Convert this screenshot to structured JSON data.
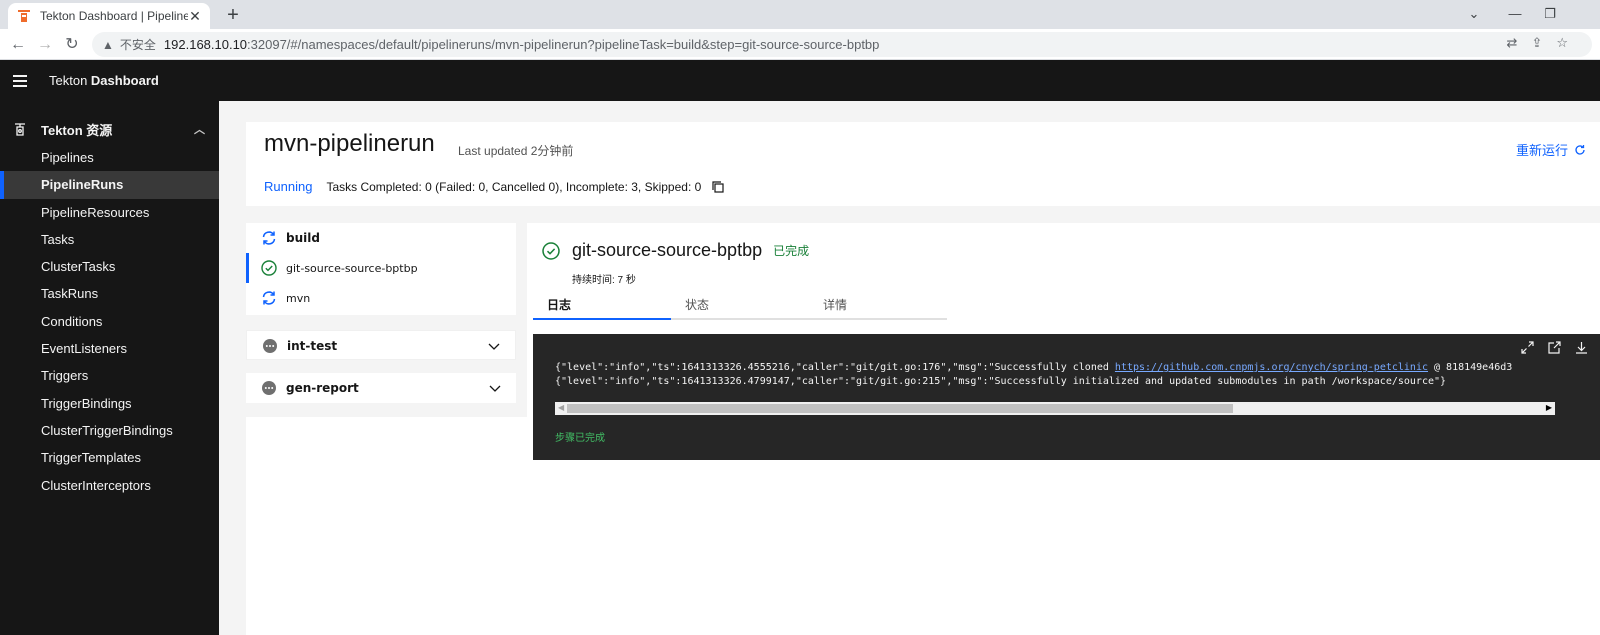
{
  "browser": {
    "tab_title": "Tekton Dashboard | PipelineRu",
    "new_tab_label": "+",
    "security_label": "不安全",
    "url_host": "192.168.10.10",
    "url_rest": ":32097/#/namespaces/default/pipelineruns/mvn-pipelinerun?pipelineTask=build&step=git-source-source-bptbp"
  },
  "app": {
    "brand_prefix": "Tekton ",
    "brand_bold": "Dashboard"
  },
  "sidebar": {
    "section_label": "Tekton 资源",
    "items": [
      {
        "label": "Pipelines"
      },
      {
        "label": "PipelineRuns"
      },
      {
        "label": "PipelineResources"
      },
      {
        "label": "Tasks"
      },
      {
        "label": "ClusterTasks"
      },
      {
        "label": "TaskRuns"
      },
      {
        "label": "Conditions"
      },
      {
        "label": "EventListeners"
      },
      {
        "label": "Triggers"
      },
      {
        "label": "TriggerBindings"
      },
      {
        "label": "ClusterTriggerBindings"
      },
      {
        "label": "TriggerTemplates"
      },
      {
        "label": "ClusterInterceptors"
      }
    ],
    "active_item": "PipelineRuns"
  },
  "pipelinerun": {
    "name": "mvn-pipelinerun",
    "last_updated": "Last updated 2分钟前",
    "rerun_label": "重新运行",
    "status": "Running",
    "tasks_summary": "Tasks Completed: 0 (Failed: 0, Cancelled 0), Incomplete: 3, Skipped: 0"
  },
  "tasks": {
    "build": {
      "label": "build",
      "steps": [
        {
          "label": "git-source-source-bptbp",
          "state": "success"
        },
        {
          "label": "mvn",
          "state": "running"
        }
      ]
    },
    "int_test": {
      "label": "int-test",
      "state": "pending"
    },
    "gen_report": {
      "label": "gen-report",
      "state": "pending"
    }
  },
  "step": {
    "name": "git-source-source-bptbp",
    "status": "已完成",
    "duration": "持续时间: 7 秒",
    "tabs": [
      {
        "label": "日志"
      },
      {
        "label": "状态"
      },
      {
        "label": "详情"
      }
    ],
    "active_tab": "日志"
  },
  "log": {
    "line1_prefix": "{\"level\":\"info\",\"ts\":1641313326.4555216,\"caller\":\"git/git.go:176\",\"msg\":\"Successfully cloned ",
    "line1_link": "https://github.com.cnpmjs.org/cnych/spring-petclinic",
    "line1_suffix": " @ 818149e46d3",
    "line2": "{\"level\":\"info\",\"ts\":1641313326.4799147,\"caller\":\"git/git.go:215\",\"msg\":\"Successfully initialized and updated submodules in path /workspace/source\"}",
    "completed_label": "步骤已完成"
  },
  "colors": {
    "accent": "#0f62fe",
    "success": "#198038",
    "header_bg": "#161616",
    "log_bg": "#262626"
  }
}
